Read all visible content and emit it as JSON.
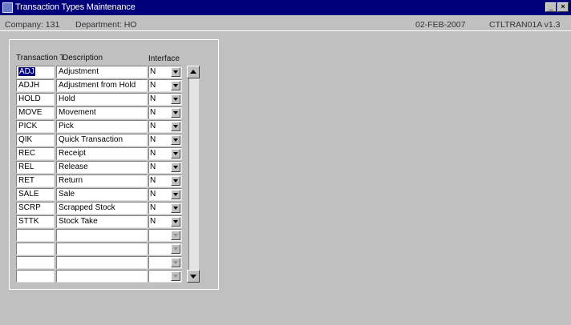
{
  "window": {
    "title": "Transaction Types Maintenance",
    "minimize_label": "_",
    "close_label": "×"
  },
  "header": {
    "company": "Company: 131",
    "department": "Department: HO",
    "date": "02-FEB-2007",
    "form_id": "CTLTRAN01A v1.3"
  },
  "columns": {
    "type": "Transaction Type",
    "description": "Description",
    "interface": "Interface"
  },
  "rows": [
    {
      "code": "ADJ",
      "description": "Adjustment",
      "interface": "N"
    },
    {
      "code": "ADJH",
      "description": "Adjustment from Hold",
      "interface": "N"
    },
    {
      "code": "HOLD",
      "description": "Hold",
      "interface": "N"
    },
    {
      "code": "MOVE",
      "description": "Movement",
      "interface": "N"
    },
    {
      "code": "PICK",
      "description": "Pick",
      "interface": "N"
    },
    {
      "code": "QIK",
      "description": "Quick Transaction",
      "interface": "N"
    },
    {
      "code": "REC",
      "description": "Receipt",
      "interface": "N"
    },
    {
      "code": "REL",
      "description": "Release",
      "interface": "N"
    },
    {
      "code": "RET",
      "description": "Return",
      "interface": "N"
    },
    {
      "code": "SALE",
      "description": "Sale",
      "interface": "N"
    },
    {
      "code": "SCRP",
      "description": "Scrapped Stock",
      "interface": "N"
    },
    {
      "code": "STTK",
      "description": "Stock Take",
      "interface": "N"
    },
    {
      "code": "",
      "description": "",
      "interface": ""
    },
    {
      "code": "",
      "description": "",
      "interface": ""
    },
    {
      "code": "",
      "description": "",
      "interface": ""
    },
    {
      "code": "",
      "description": "",
      "interface": ""
    }
  ],
  "colors": {
    "titlebar": "#00007b",
    "background": "#c0c0c0",
    "selection": "#000080"
  }
}
